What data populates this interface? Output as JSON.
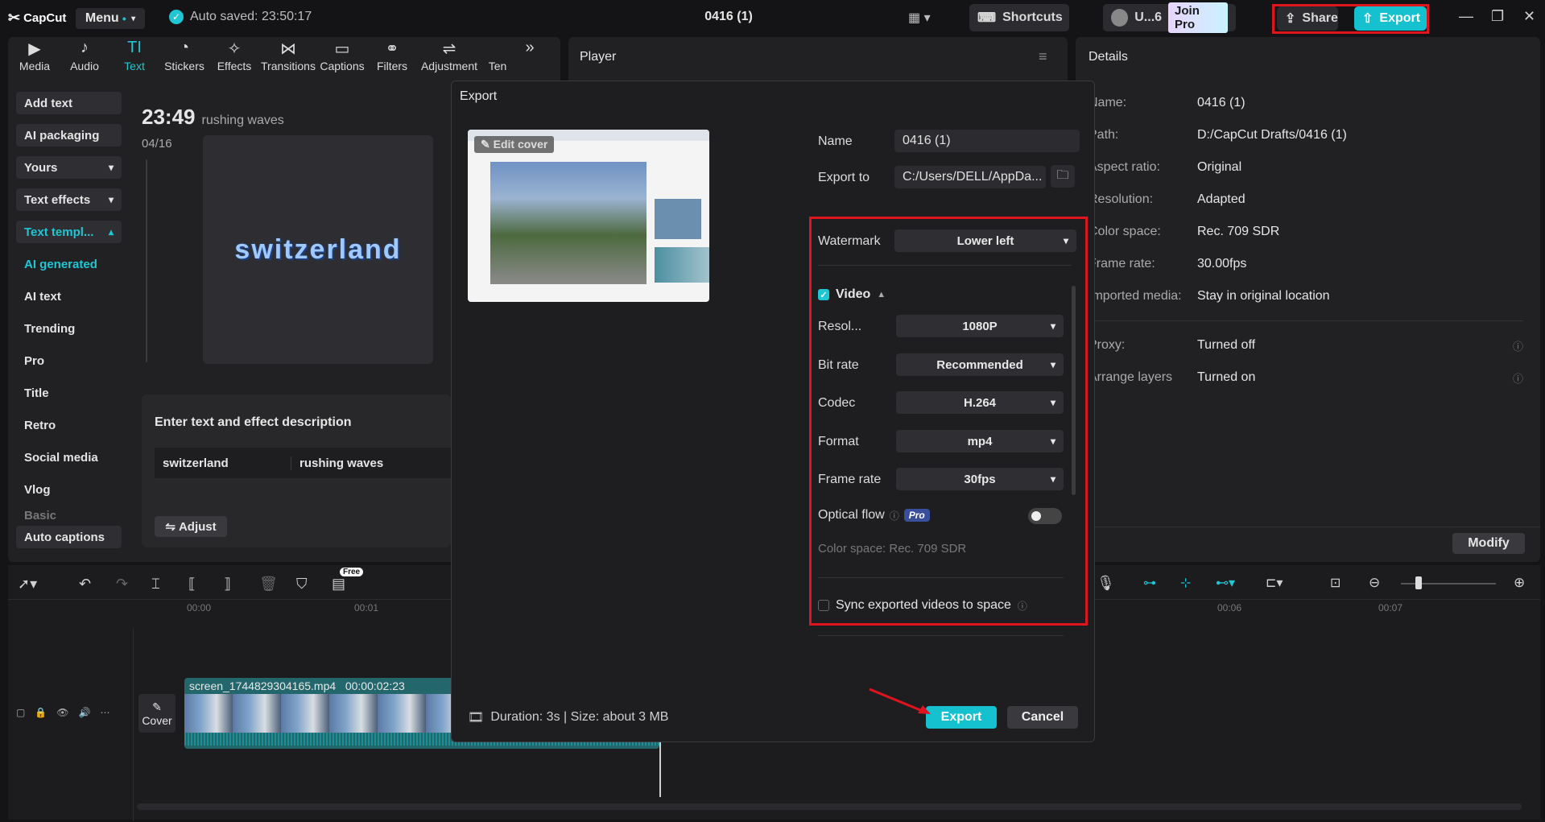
{
  "app": {
    "logo": "CapCut",
    "menu": "Menu",
    "autosave": "Auto saved: 23:50:17",
    "project_title": "0416 (1)",
    "shortcuts": "Shortcuts",
    "user": "U...6",
    "join_pro": "Join Pro",
    "share": "Share",
    "export": "Export"
  },
  "toolbar": {
    "items": [
      {
        "label": "Media",
        "icon": "media-icon"
      },
      {
        "label": "Audio",
        "icon": "audio-icon"
      },
      {
        "label": "Text",
        "icon": "text-icon"
      },
      {
        "label": "Stickers",
        "icon": "stickers-icon"
      },
      {
        "label": "Effects",
        "icon": "effects-icon"
      },
      {
        "label": "Transitions",
        "icon": "transitions-icon"
      },
      {
        "label": "Captions",
        "icon": "captions-icon"
      },
      {
        "label": "Filters",
        "icon": "filters-icon"
      },
      {
        "label": "Adjustment",
        "icon": "adjustment-icon"
      },
      {
        "label": "Ten",
        "icon": "templates-icon"
      }
    ],
    "active": "Text"
  },
  "sidebar": {
    "items": [
      "Add text",
      "AI packaging",
      "Yours",
      "Text effects",
      "Text templ...",
      "AI generated",
      "AI text",
      "Trending",
      "Pro",
      "Title",
      "Retro",
      "Social media",
      "Vlog",
      "Basic"
    ],
    "auto_captions": "Auto captions"
  },
  "text_panel": {
    "time": "23:49",
    "subtitle": "rushing waves",
    "date": "04/16",
    "preview_text": "switzerland",
    "desc_heading": "Enter text and effect description",
    "word1": "switzerland",
    "word2": "rushing waves",
    "adjust": "Adjust"
  },
  "player": {
    "title": "Player"
  },
  "details": {
    "title": "Details",
    "rows": [
      {
        "label": "Name:",
        "value": "0416 (1)"
      },
      {
        "label": "Path:",
        "value": "D:/CapCut Drafts/0416 (1)"
      },
      {
        "label": "Aspect ratio:",
        "value": "Original"
      },
      {
        "label": "Resolution:",
        "value": "Adapted"
      },
      {
        "label": "Color space:",
        "value": "Rec. 709 SDR"
      },
      {
        "label": "Frame rate:",
        "value": "30.00fps"
      },
      {
        "label": "Imported media:",
        "value": "Stay in original location"
      },
      {
        "label": "Proxy:",
        "value": "Turned off"
      },
      {
        "label": "Arrange layers",
        "value": "Turned on"
      }
    ],
    "modify": "Modify"
  },
  "export_dialog": {
    "title": "Export",
    "edit_cover": "Edit cover",
    "name_label": "Name",
    "name_value": "0416 (1)",
    "export_to_label": "Export to",
    "export_to_value": "C:/Users/DELL/AppDa...",
    "watermark_label": "Watermark",
    "watermark_value": "Lower left",
    "video_label": "Video",
    "video_checked": true,
    "resolution_label": "Resol...",
    "resolution_value": "1080P",
    "bitrate_label": "Bit rate",
    "bitrate_value": "Recommended",
    "codec_label": "Codec",
    "codec_value": "H.264",
    "format_label": "Format",
    "format_value": "mp4",
    "framerate_label": "Frame rate",
    "framerate_value": "30fps",
    "optical_flow_label": "Optical flow",
    "pro": "Pro",
    "optical_flow_on": false,
    "color_space": "Color space: Rec. 709 SDR",
    "sync_label": "Sync exported videos to space",
    "sync_checked": false,
    "footer": "Duration: 3s | Size: about 3 MB",
    "export_btn": "Export",
    "cancel_btn": "Cancel"
  },
  "timeline": {
    "free_badge": "Free",
    "ruler": [
      "00:00",
      "00:01",
      "00:06",
      "00:07"
    ],
    "clip_label": "screen_1744829304165.mp4   00:00:02:23",
    "cover": "Cover"
  },
  "colors": {
    "accent": "#15c0cf",
    "highlight": "#e0141e",
    "panel": "#212124",
    "bg": "#141416"
  }
}
